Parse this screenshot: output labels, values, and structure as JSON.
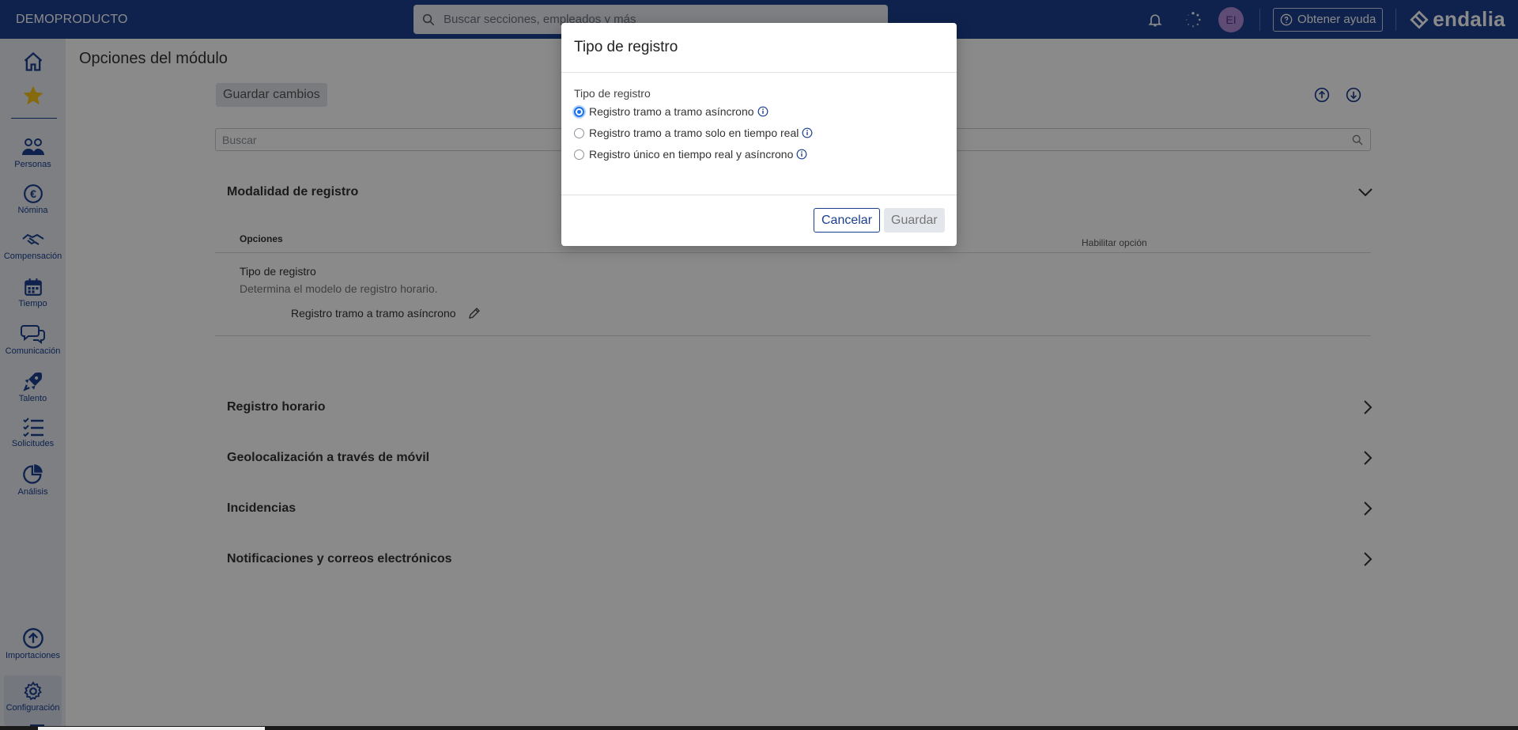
{
  "topbar": {
    "brand": "DEMOPRODUCTO",
    "search_placeholder": "Buscar secciones, empleados y más",
    "avatar_initials": "EI",
    "help_label": "Obtener ayuda",
    "logo_text": "endalia"
  },
  "sidebar": {
    "items": [
      {
        "label": "",
        "icon": "home-icon"
      },
      {
        "label": "",
        "icon": "star-icon"
      },
      {
        "label": "Personas",
        "icon": "people-icon"
      },
      {
        "label": "Nómina",
        "icon": "euro-icon"
      },
      {
        "label": "Compensación",
        "icon": "handshake-icon"
      },
      {
        "label": "Tiempo",
        "icon": "calendar-icon"
      },
      {
        "label": "Comunicación",
        "icon": "chat-icon"
      },
      {
        "label": "Talento",
        "icon": "rocket-icon"
      },
      {
        "label": "Solicitudes",
        "icon": "checklist-icon"
      },
      {
        "label": "Análisis",
        "icon": "pie-chart-icon"
      },
      {
        "label": "Importaciones",
        "icon": "upload-icon"
      },
      {
        "label": "Configuración",
        "icon": "gear-icon"
      }
    ]
  },
  "main": {
    "page_title": "Opciones del módulo",
    "save_changes": "Guardar cambios",
    "search_placeholder": "Buscar",
    "sections": {
      "modalidad": "Modalidad de registro",
      "registro_horario": "Registro horario",
      "geolocalizacion": "Geolocalización a través de móvil",
      "incidencias": "Incidencias",
      "notificaciones": "Notificaciones y correos electrónicos"
    },
    "options_table": {
      "col_options": "Opciones",
      "col_enable": "Habilitar opción",
      "row_name": "Tipo de registro",
      "row_desc": "Determina el modelo de registro horario.",
      "row_value": "Registro tramo a tramo asíncrono"
    }
  },
  "modal": {
    "title": "Tipo de registro",
    "field_label": "Tipo de registro",
    "options": [
      {
        "label": "Registro tramo a tramo asíncrono",
        "checked": true
      },
      {
        "label": "Registro tramo a tramo solo en tiempo real",
        "checked": false
      },
      {
        "label": "Registro único en tiempo real y asíncrono",
        "checked": false
      }
    ],
    "cancel": "Cancelar",
    "save": "Guardar"
  },
  "colors": {
    "brand_blue": "#1b3f8f",
    "radio_blue": "#1a73e8",
    "star_yellow": "#f5c518"
  }
}
